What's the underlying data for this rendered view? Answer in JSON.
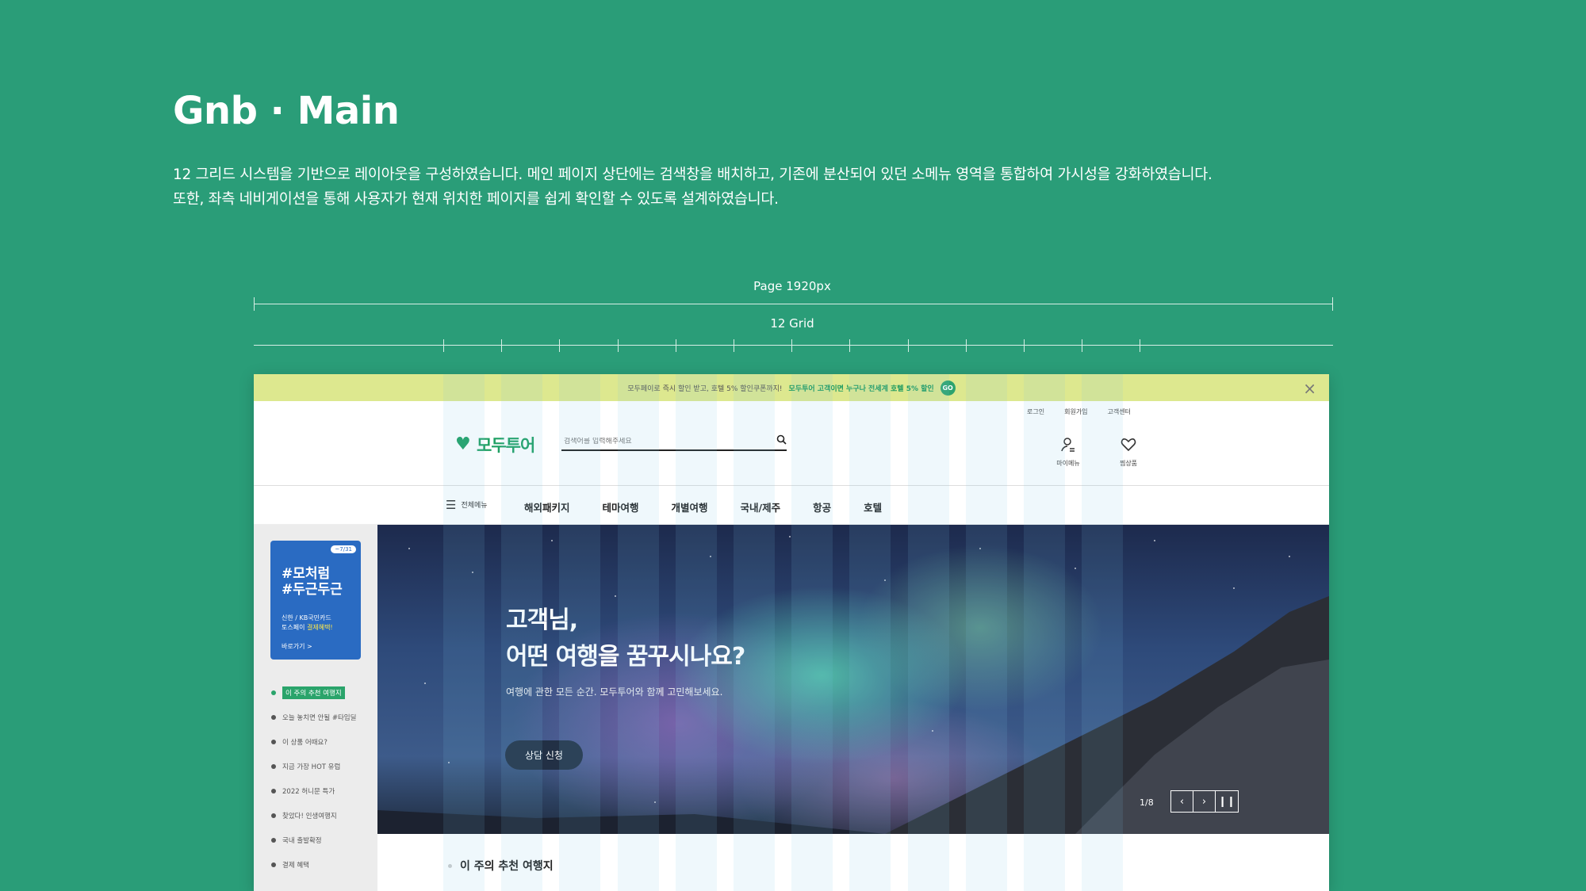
{
  "page": {
    "title": "Gnb · Main",
    "description_line1": "12 그리드 시스템을 기반으로 레이아웃을 구성하였습니다. 메인 페이지 상단에는 검색창을 배치하고, 기존에 분산되어 있던 소메뉴 영역을 통합하여 가시성을 강화하였습니다.",
    "description_line2": "또한, 좌측 네비게이션을 통해 사용자가 현재 위치한 페이지를 쉽게 확인할 수 있도록 설계하였습니다.",
    "ruler_page_label": "Page 1920px",
    "ruler_grid_label": "12 Grid"
  },
  "promo": {
    "text": "모두페이로 즉시 할인 받고, 호텔 5% 할인쿠폰까지!",
    "highlight": "모두투어 고객이면 누구나 전세계 호텔 5% 할인",
    "go": "GO"
  },
  "header": {
    "logo": "모두투어",
    "search_placeholder": "검색어를 입력해주세요",
    "util_links": [
      "로그인",
      "회원가입",
      "고객센터"
    ],
    "my_menu": "마이메뉴",
    "wishlist": "찜상품"
  },
  "nav": {
    "menu_label": "전체메뉴",
    "items": [
      "해외패키지",
      "테마여행",
      "개별여행",
      "국내/제주",
      "항공",
      "호텔"
    ]
  },
  "hero": {
    "headline_1": "고객님,",
    "headline_2": "어떤 여행을 꿈꾸시나요?",
    "subtext": "여행에 관한 모든 순간. 모두투어와 함께 고민해보세요.",
    "cta": "상담 신청",
    "counter": "1/8"
  },
  "sidebar": {
    "banner_date": "~7/31",
    "banner_title_1": "#모처럼",
    "banner_title_2": "#두근두근",
    "banner_desc_1": "신한 / KB국민카드",
    "banner_desc_2a": "토스페이 ",
    "banner_desc_2b": "결제혜택!",
    "banner_link": "바로가기 >",
    "items": [
      "이 주의 추천 여행지",
      "오늘 놓치면 안될 #타임딜",
      "이 상품 어때요?",
      "지금 가장 HOT 유럽",
      "2022 허니문 특가",
      "찾았다! 인생여행지",
      "국내 출발확정",
      "결제 혜택"
    ]
  },
  "section": {
    "title": "이 주의 추천 여행지"
  }
}
